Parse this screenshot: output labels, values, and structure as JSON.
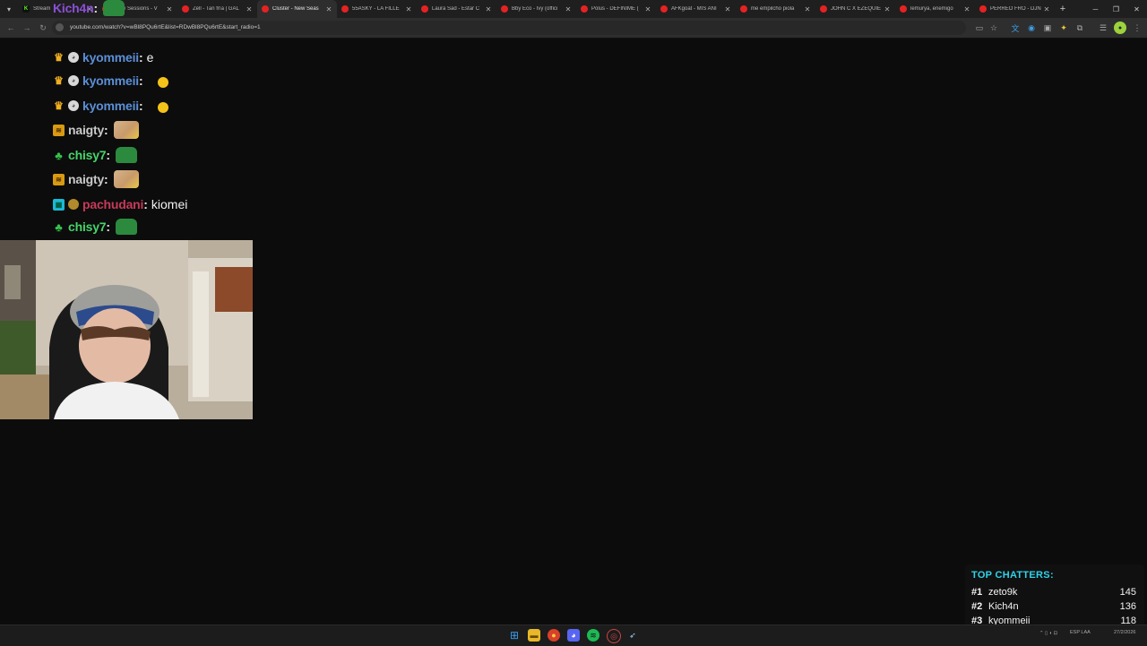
{
  "browser": {
    "tabs": [
      {
        "label": "Stream",
        "favicon": "kick",
        "active": false
      },
      {
        "label": "Gaby Sessions - V",
        "favicon": "youtube",
        "active": false
      },
      {
        "label": "Zell - Tan fría | GAL",
        "favicon": "youtube",
        "active": false
      },
      {
        "label": "Cluster - New Seas",
        "favicon": "youtube",
        "active": true
      },
      {
        "label": "55ASKY - LA FILLE",
        "favicon": "youtube",
        "active": false
      },
      {
        "label": "Laura Sad - Estar C",
        "favicon": "youtube",
        "active": false
      },
      {
        "label": "Bby Eco - Ivy (offici",
        "favicon": "youtube",
        "active": false
      },
      {
        "label": "Polus - DEFINIME (",
        "favicon": "youtube",
        "active": false
      },
      {
        "label": "AFKgoat - MIS ANI",
        "favicon": "youtube",
        "active": false
      },
      {
        "label": "me empilcho piola",
        "favicon": "youtube",
        "active": false
      },
      {
        "label": "JOHN C X EZEQUIE",
        "favicon": "youtube",
        "active": false
      },
      {
        "label": "lemurya, enemigo",
        "favicon": "youtube",
        "active": false
      },
      {
        "label": "PERREO FRO - DJN",
        "favicon": "youtube",
        "active": false
      }
    ],
    "url": "youtube.com/watch?v=wBl8PQu6rtE&list=RDwBl8PQu6rtE&start_radio=1"
  },
  "chat": {
    "messages": [
      {
        "user": "Kich4n",
        "color": "#8b4fd6",
        "badges": [],
        "text": "",
        "emote": "pepe"
      },
      {
        "user": "kyommeii",
        "color": "#5b8fd6",
        "badges": [
          "crown",
          "globe"
        ],
        "text": "e",
        "emote": ""
      },
      {
        "user": "kyommeii",
        "color": "#5b8fd6",
        "badges": [
          "crown",
          "globe"
        ],
        "text": "",
        "emote": "smile"
      },
      {
        "user": "kyommeii",
        "color": "#5b8fd6",
        "badges": [
          "crown",
          "globe"
        ],
        "text": "",
        "emote": "smile"
      },
      {
        "user": "naigty",
        "color": "#c9c9c9",
        "badges": [
          "sub"
        ],
        "text": "",
        "emote": "cat"
      },
      {
        "user": "chisy7",
        "color": "#46d46a",
        "badges": [
          "leaf"
        ],
        "text": "",
        "emote": "pepe"
      },
      {
        "user": "naigty",
        "color": "#c9c9c9",
        "badges": [
          "sub"
        ],
        "text": "",
        "emote": "cat"
      },
      {
        "user": "pachudani",
        "color": "#c63a5a",
        "badges": [
          "grid",
          "coin"
        ],
        "text": "kiomei",
        "emote": ""
      },
      {
        "user": "chisy7",
        "color": "#46d46a",
        "badges": [
          "leaf"
        ],
        "text": "",
        "emote": "pepe"
      }
    ]
  },
  "top_chatters": {
    "title": "TOP CHATTERS:",
    "entries": [
      {
        "rank": "#1",
        "name": "zeto9k",
        "count": "145"
      },
      {
        "rank": "#2",
        "name": "Kich4n",
        "count": "136"
      },
      {
        "rank": "#3",
        "name": "kyommeii",
        "count": "118"
      }
    ]
  },
  "taskbar": {
    "lang": "ESP LAA",
    "date": "27/2/2026"
  }
}
